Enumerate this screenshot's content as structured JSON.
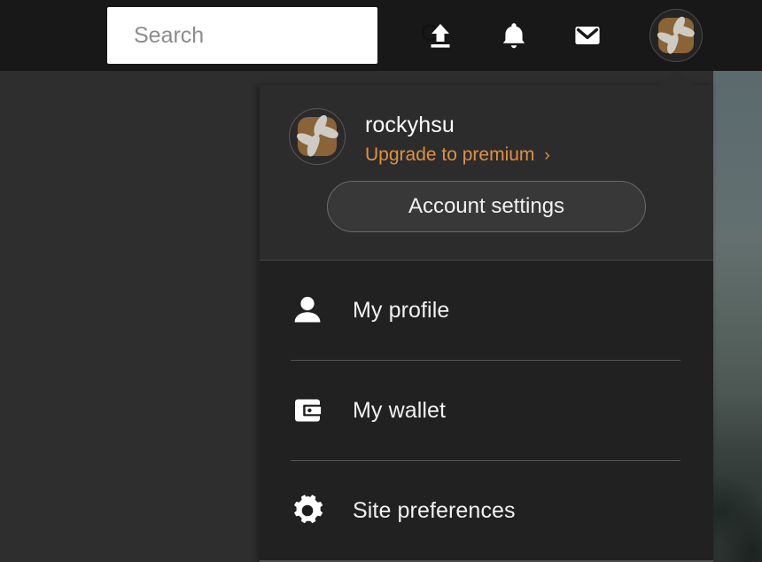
{
  "colors": {
    "topbar_bg": "#181818",
    "page_bg": "#2e2e2e",
    "dropdown_head_bg": "#2c2c2c",
    "dropdown_body_bg": "#212121",
    "accent_premium": "#e0913f",
    "text_primary": "#ffffff",
    "search_bg": "#ffffff",
    "avatar_brown": "#8a6336"
  },
  "topbar": {
    "search": {
      "placeholder": "Search",
      "value": "",
      "icon": "search-icon"
    },
    "actions": [
      {
        "name": "upload-icon",
        "label": "Upload"
      },
      {
        "name": "bell-icon",
        "label": "Notifications"
      },
      {
        "name": "mail-icon",
        "label": "Messages"
      }
    ],
    "avatar": {
      "name": "user-avatar",
      "alt": "rockyhsu"
    }
  },
  "dropdown": {
    "username": "rockyhsu",
    "upgrade_label": "Upgrade to premium",
    "upgrade_chevron": "›",
    "account_settings_label": "Account settings",
    "menu_items": [
      {
        "icon": "person-icon",
        "label": "My profile"
      },
      {
        "icon": "wallet-icon",
        "label": "My wallet"
      },
      {
        "icon": "gear-icon",
        "label": "Site preferences"
      }
    ]
  }
}
